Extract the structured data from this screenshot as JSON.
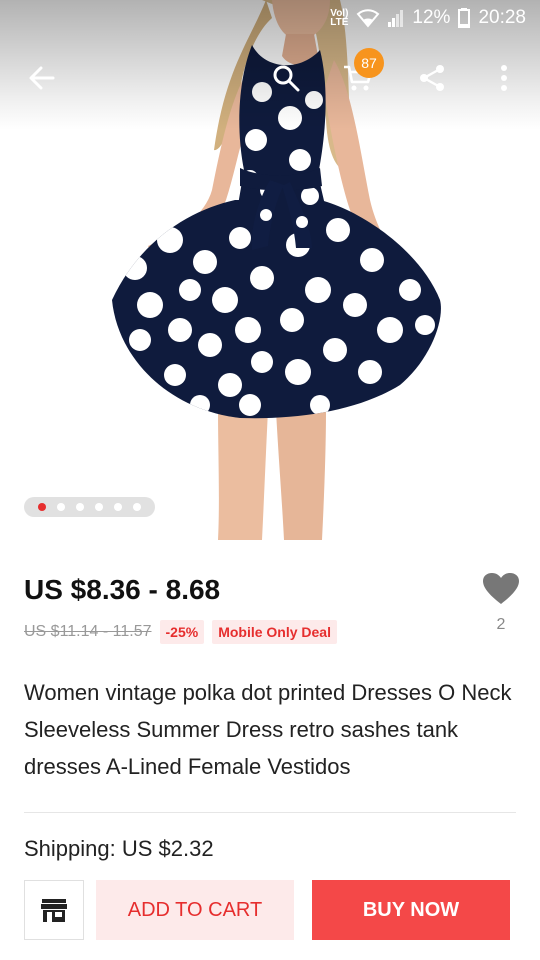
{
  "status_bar": {
    "network_label_top": "Vol)",
    "network_label_bottom": "LTE",
    "battery": "12%",
    "time": "20:28"
  },
  "toolbar": {
    "cart_count": "87",
    "icons": [
      "back-arrow-icon",
      "search-icon",
      "cart-icon",
      "share-icon",
      "more-vertical-icon"
    ]
  },
  "carousel": {
    "total": 6,
    "active": 1
  },
  "product": {
    "price": "US $8.36 - 8.68",
    "original_price": "US $11.14 - 11.57",
    "discount": "-25%",
    "deal_badge": "Mobile Only Deal",
    "wishlist_count": "2",
    "title": "Women vintage polka dot printed Dresses O Neck Sleeveless Summer Dress retro sashes tank dresses A-Lined Female Vestidos",
    "shipping": "Shipping: US $2.32"
  },
  "actions": {
    "add_to_cart": "ADD TO CART",
    "buy_now": "BUY NOW"
  },
  "colors": {
    "accent_red": "#f44848",
    "soft_red": "#fdeaea",
    "badge_orange": "#f7941d",
    "dress_navy": "#0f1b3d"
  }
}
